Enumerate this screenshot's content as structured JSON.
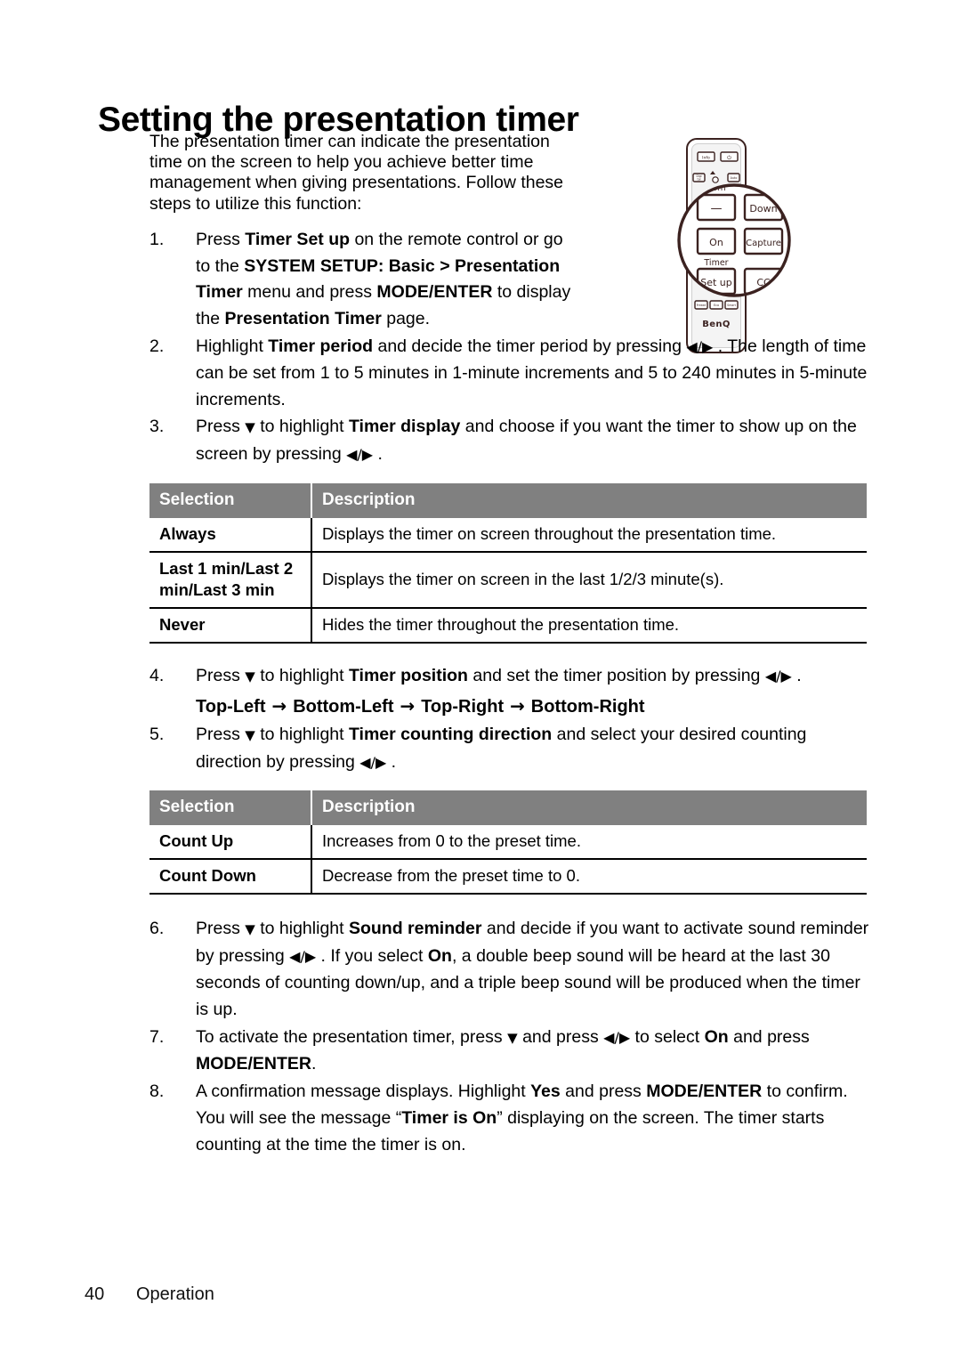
{
  "document": {
    "title": "Setting the presentation timer",
    "intro": "The presentation timer can indicate the presentation time on the screen to help you achieve better time management when giving presentations. Follow these steps to utilize this function:",
    "footer": {
      "page_number": "40",
      "section": "Operation"
    }
  },
  "glyphs": {
    "left_right": "◀ / ▶",
    "left_right_tight": "◀/▶",
    "down": "▼",
    "right_arrow": "→"
  },
  "steps": [
    {
      "num": "1.",
      "parts": [
        {
          "t": "Press ",
          "b": false
        },
        {
          "t": "Timer Set up",
          "b": true
        },
        {
          "t": " on the remote control or go to the ",
          "b": false
        },
        {
          "t": "SYSTEM SETUP: Basic >",
          "b": true
        },
        {
          "t": " ",
          "b": false
        },
        {
          "t": "Presentation Timer",
          "b": true
        },
        {
          "t": " menu and press ",
          "b": false
        },
        {
          "t": "MODE/ENTER",
          "b": true
        },
        {
          "t": " to display the ",
          "b": false
        },
        {
          "t": "Presentation Timer",
          "b": true
        },
        {
          "t": " page.",
          "b": false
        }
      ]
    },
    {
      "num": "2.",
      "parts": [
        {
          "t": "Highlight ",
          "b": false
        },
        {
          "t": "Timer period",
          "b": true
        },
        {
          "t": " and decide the timer period by pressing ",
          "b": false
        },
        {
          "t": "◀/▶",
          "b": false,
          "glyph": true
        },
        {
          "t": " . The length of time can be set from 1 to 5 minutes in 1-minute increments and 5 to 240 minutes in 5-minute increments.",
          "b": false
        }
      ]
    },
    {
      "num": "3.",
      "parts": [
        {
          "t": "Press ",
          "b": false
        },
        {
          "t": "▼",
          "b": false,
          "glyph": true
        },
        {
          "t": " to highlight ",
          "b": false
        },
        {
          "t": "Timer display",
          "b": true
        },
        {
          "t": " and choose if you want the timer to show up on the screen by pressing ",
          "b": false
        },
        {
          "t": "◀/▶",
          "b": false,
          "glyph": true
        },
        {
          "t": " .",
          "b": false
        }
      ]
    },
    {
      "num": "4.",
      "parts": [
        {
          "t": "Press ",
          "b": false
        },
        {
          "t": "▼",
          "b": false,
          "glyph": true
        },
        {
          "t": " to highlight ",
          "b": false
        },
        {
          "t": "Timer position",
          "b": true
        },
        {
          "t": " and set the timer position by pressing ",
          "b": false
        },
        {
          "t": "◀/▶",
          "b": false,
          "glyph": true
        },
        {
          "t": " .",
          "b": false
        }
      ]
    },
    {
      "num": "5.",
      "parts": [
        {
          "t": "Press ",
          "b": false
        },
        {
          "t": "▼",
          "b": false,
          "glyph": true
        },
        {
          "t": " to highlight ",
          "b": false
        },
        {
          "t": "Timer counting direction",
          "b": true
        },
        {
          "t": " and select your desired counting direction by pressing ",
          "b": false
        },
        {
          "t": "◀/▶",
          "b": false,
          "glyph": true
        },
        {
          "t": " .",
          "b": false
        }
      ]
    },
    {
      "num": "6.",
      "parts": [
        {
          "t": "Press ",
          "b": false
        },
        {
          "t": "▼",
          "b": false,
          "glyph": true
        },
        {
          "t": " to highlight ",
          "b": false
        },
        {
          "t": "Sound reminder",
          "b": true
        },
        {
          "t": " and decide if you want to activate sound reminder by pressing ",
          "b": false
        },
        {
          "t": "◀/▶",
          "b": false,
          "glyph": true
        },
        {
          "t": " . If you select ",
          "b": false
        },
        {
          "t": "On",
          "b": true
        },
        {
          "t": ", a double beep sound will be heard at the last 30 seconds of counting down/up, and a triple beep sound will be produced when the timer is up.",
          "b": false
        }
      ]
    },
    {
      "num": "7.",
      "parts": [
        {
          "t": "To activate the presentation timer, press ",
          "b": false
        },
        {
          "t": "▼",
          "b": false,
          "glyph": true
        },
        {
          "t": " and press ",
          "b": false
        },
        {
          "t": "◀/▶",
          "b": false,
          "glyph": true
        },
        {
          "t": " to select ",
          "b": false
        },
        {
          "t": "On",
          "b": true
        },
        {
          "t": " and press ",
          "b": false
        },
        {
          "t": "MODE/ENTER",
          "b": true
        },
        {
          "t": ".",
          "b": false
        }
      ]
    },
    {
      "num": "8.",
      "parts": [
        {
          "t": "A confirmation message displays. Highlight ",
          "b": false
        },
        {
          "t": "Yes",
          "b": true
        },
        {
          "t": " and press ",
          "b": false
        },
        {
          "t": "MODE/ENTER",
          "b": true
        },
        {
          "t": " to confirm. You will see the message “",
          "b": false
        },
        {
          "t": "Timer is On",
          "b": true
        },
        {
          "t": "” displaying on the  screen. The timer starts counting at the time the timer is on.",
          "b": false
        }
      ]
    }
  ],
  "position_sequence": {
    "items": [
      "Top-Left",
      "Bottom-Left",
      "Top-Right",
      "Bottom-Right"
    ],
    "separator": "→"
  },
  "tables": [
    {
      "name": "timer-display-table",
      "headers": [
        "Selection",
        "Description"
      ],
      "rows": [
        [
          "Always",
          "Displays the timer on screen throughout the presentation time."
        ],
        [
          "Last 1 min/Last 2 min/Last 3 min",
          "Displays the timer on screen in the last  1/2/3 minute(s)."
        ],
        [
          "Never",
          "Hides the timer throughout the presentation time."
        ]
      ]
    },
    {
      "name": "counting-direction-table",
      "headers": [
        "Selection",
        "Description"
      ],
      "rows": [
        [
          "Count Up",
          "Increases from 0 to the preset time."
        ],
        [
          "Count Down",
          "Decrease from the preset time to 0."
        ]
      ]
    }
  ],
  "remote": {
    "brand": "BenQ",
    "section_labels": {
      "digital_zoom": "gital Zoom",
      "timer": "Timer"
    },
    "buttons": [
      "−",
      "Down",
      "On",
      "Capture",
      "Set up",
      "CC"
    ],
    "top_buttons": [
      "Info",
      "⏻"
    ],
    "colors": {
      "outline": "#3b2220",
      "body_fill": "#ffffff",
      "inner_fill": "#f2f2f2"
    }
  }
}
